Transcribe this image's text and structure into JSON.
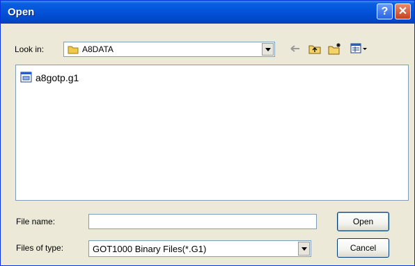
{
  "titlebar": {
    "title": "Open",
    "help_glyph": "?",
    "close_glyph": "✕"
  },
  "toolbar": {
    "look_in_label": "Look in:",
    "look_in_value": "A8DATA",
    "icons": [
      "folder-icon",
      "back-arrow-icon",
      "up-folder-icon",
      "new-folder-icon",
      "view-menu-icon"
    ]
  },
  "file_list": {
    "items": [
      {
        "name": "a8gotp.g1",
        "icon": "file-icon"
      }
    ]
  },
  "file_name": {
    "label": "File name:",
    "value": ""
  },
  "file_type": {
    "label": "Files of type:",
    "value": "GOT1000 Binary Files(*.G1)"
  },
  "buttons": {
    "open": "Open",
    "cancel": "Cancel"
  },
  "colors": {
    "titlebar": "#0352d8",
    "dialog_bg": "#ece9d8",
    "close": "#c8401c"
  }
}
